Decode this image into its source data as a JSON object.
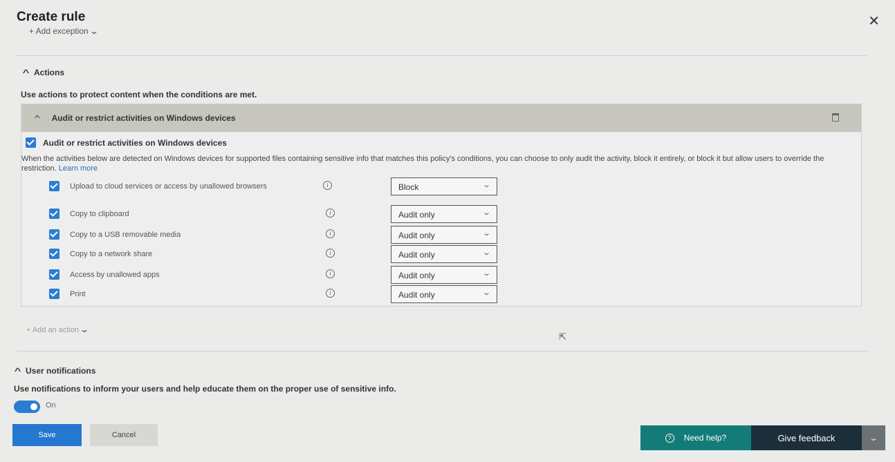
{
  "header": {
    "title": "Create rule",
    "close_icon": "close-icon"
  },
  "add_exception": {
    "label": "+ Add exception"
  },
  "actions": {
    "heading": "Actions",
    "description": "Use actions to protect content when the conditions are met.",
    "card": {
      "title": "Audit or restrict activities on Windows devices",
      "checkbox_label": "Audit or restrict activities on Windows devices",
      "description": "When the activities below are detected on Windows devices for supported files containing sensitive info that matches this policy's conditions, you can choose to only audit the activity, block it entirely, or block it but allow users to override the restriction.",
      "learn_more": "Learn more",
      "activities": [
        {
          "label": "Upload to cloud services or access by unallowed browsers",
          "value": "Block"
        },
        {
          "label": "Copy to clipboard",
          "value": "Audit only"
        },
        {
          "label": "Copy to a USB removable media",
          "value": "Audit only"
        },
        {
          "label": "Copy to a network share",
          "value": "Audit only"
        },
        {
          "label": "Access by unallowed apps",
          "value": "Audit only"
        },
        {
          "label": "Print",
          "value": "Audit only"
        }
      ]
    },
    "add_action": "+ Add an action"
  },
  "user_notifications": {
    "heading": "User notifications",
    "description": "Use notifications to inform your users and help educate them on the proper use of sensitive info.",
    "toggle_label": "On",
    "toggle_state": "on"
  },
  "footer": {
    "save": "Save",
    "cancel": "Cancel",
    "need_help": "Need help?",
    "give_feedback": "Give feedback"
  },
  "colors": {
    "primary": "#2478cf",
    "help": "#147c78",
    "feedback": "#1c2e3a",
    "card_header": "#c7c7c0"
  }
}
